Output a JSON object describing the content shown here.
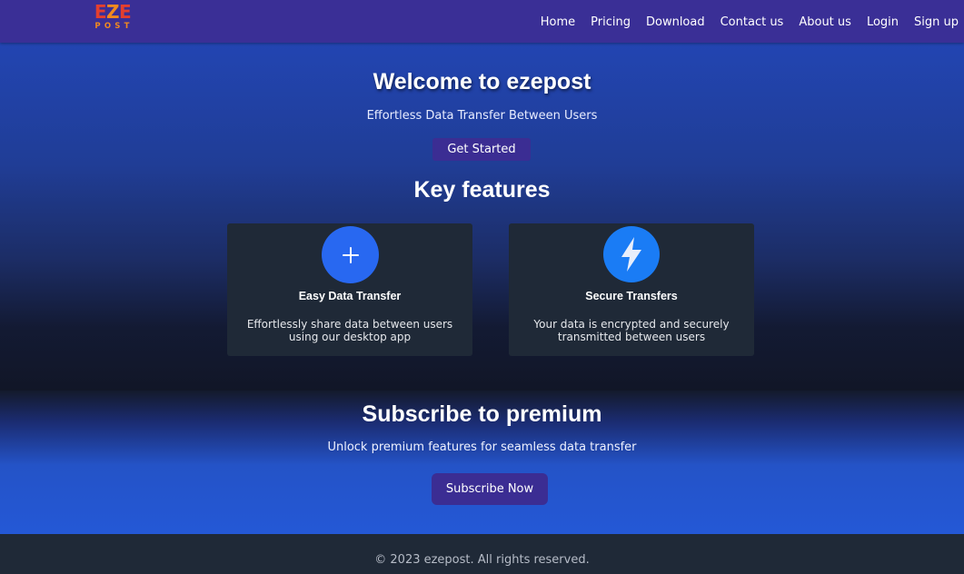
{
  "brand": {
    "logo_top_a": "E",
    "logo_top_z": "Z",
    "logo_top_b": "E",
    "logo_bottom": "POST"
  },
  "nav": {
    "items": [
      {
        "label": "Home"
      },
      {
        "label": "Pricing"
      },
      {
        "label": "Download"
      },
      {
        "label": "Contact us"
      },
      {
        "label": "About us"
      },
      {
        "label": "Login"
      },
      {
        "label": "Sign up"
      }
    ]
  },
  "hero": {
    "title": "Welcome to ezepost",
    "subtitle": "Effortless Data Transfer Between Users",
    "cta_label": "Get Started"
  },
  "features": {
    "heading": "Key features",
    "cards": [
      {
        "icon": "plus-icon",
        "title": "Easy Data Transfer",
        "description": "Effortlessly share data between users using our desktop app"
      },
      {
        "icon": "lightning-icon",
        "title": "Secure Transfers",
        "description": "Your data is encrypted and securely transmitted between users"
      }
    ]
  },
  "subscribe": {
    "title": "Subscribe to premium",
    "text": "Unlock premium features for seamless data transfer",
    "button_label": "Subscribe Now"
  },
  "footer": {
    "text": "© 2023 ezepost. All rights reserved."
  },
  "colors": {
    "navbar": "#3a2f96",
    "button": "#3b2d93",
    "card": "#1f2937",
    "icon_blue": "#2868f1",
    "logo_red": "#e43f2f",
    "logo_orange": "#f28a1e"
  }
}
